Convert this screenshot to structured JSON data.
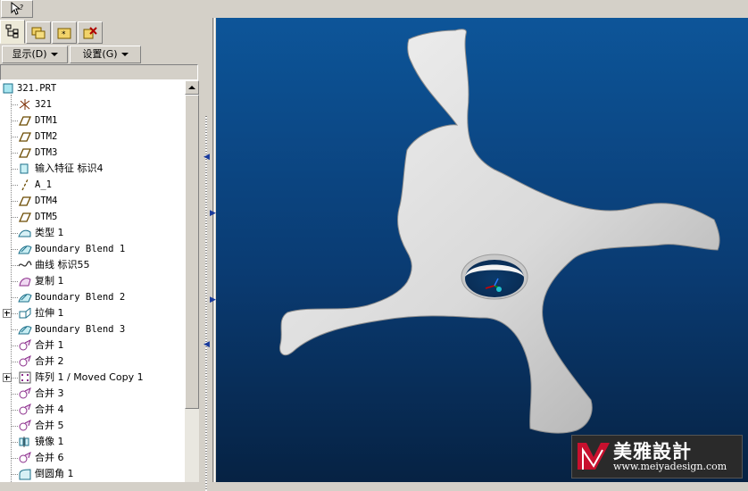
{
  "toolbar": {
    "select_tool_icon": "select-arrow-icon"
  },
  "tabs": [
    {
      "icon": "model-tree-icon",
      "active": true
    },
    {
      "icon": "folder-browser-icon",
      "active": false
    },
    {
      "icon": "favorites-icon",
      "active": false
    },
    {
      "icon": "connections-icon",
      "active": false
    }
  ],
  "menus": {
    "display_label": "显示(D)",
    "settings_label": "设置(G)"
  },
  "tree": {
    "root": {
      "label": "321.PRT",
      "icon": "part-icon"
    },
    "items": [
      {
        "label": "321",
        "icon": "coordinate-system-icon"
      },
      {
        "label": "DTM1",
        "icon": "datum-plane-icon"
      },
      {
        "label": "DTM2",
        "icon": "datum-plane-icon"
      },
      {
        "label": "DTM3",
        "icon": "datum-plane-icon"
      },
      {
        "label": "输入特征 标识4",
        "icon": "import-feature-icon"
      },
      {
        "label": "A_1",
        "icon": "datum-axis-icon"
      },
      {
        "label": "DTM4",
        "icon": "datum-plane-icon"
      },
      {
        "label": "DTM5",
        "icon": "datum-plane-icon"
      },
      {
        "label": "类型 1",
        "icon": "surface-icon"
      },
      {
        "label": "Boundary Blend 1",
        "icon": "boundary-blend-icon"
      },
      {
        "label": "曲线 标识55",
        "icon": "curve-icon"
      },
      {
        "label": "复制 1",
        "icon": "copy-icon"
      },
      {
        "label": "Boundary Blend 2",
        "icon": "boundary-blend-icon"
      },
      {
        "label": "拉伸 1",
        "icon": "extrude-icon",
        "expandable": true
      },
      {
        "label": "Boundary Blend 3",
        "icon": "boundary-blend-icon"
      },
      {
        "label": "合并 1",
        "icon": "merge-icon"
      },
      {
        "label": "合并 2",
        "icon": "merge-icon"
      },
      {
        "label": "阵列 1 / Moved Copy 1",
        "icon": "pattern-icon",
        "expandable": true
      },
      {
        "label": "合并 3",
        "icon": "merge-icon"
      },
      {
        "label": "合并 4",
        "icon": "merge-icon"
      },
      {
        "label": "合并 5",
        "icon": "merge-icon"
      },
      {
        "label": "镜像 1",
        "icon": "mirror-icon"
      },
      {
        "label": "合并 6",
        "icon": "merge-icon"
      },
      {
        "label": "倒圆角 1",
        "icon": "round-icon"
      }
    ]
  },
  "viewport": {
    "background_top": "#0d5599",
    "background_bottom": "#062243",
    "model_color": "#d8d8d8"
  },
  "watermark": {
    "title": "美雅設計",
    "url": "www.meiyadesign.com",
    "icon": "meiya-logo-icon"
  }
}
